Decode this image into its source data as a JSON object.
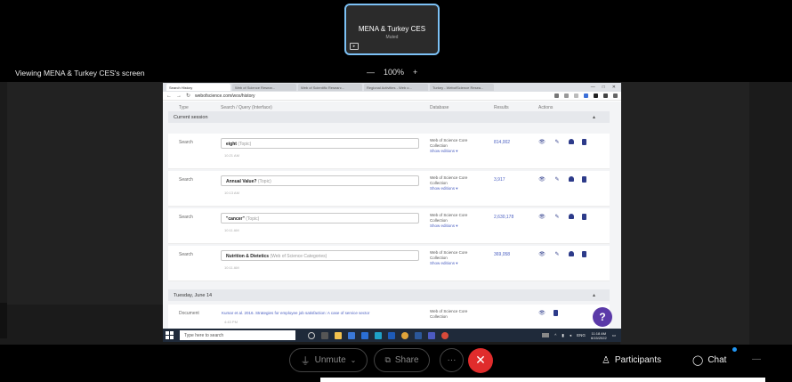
{
  "presenter_tile": {
    "name": "MENA & Turkey CES",
    "subtitle": "Muted"
  },
  "viewing_label": "Viewing MENA & Turkey CES's screen",
  "zoom_control": {
    "minus": "—",
    "level": "100%",
    "plus": "+"
  },
  "browser": {
    "tabs": [
      "Search History",
      "Web of Science Resear...",
      "Web of Scientific Researc...",
      "Regional Activities - Web o...",
      "Turkey - WebofScience Resea..."
    ],
    "window_controls": [
      "—",
      "□",
      "✕"
    ],
    "url": "webofscience.com/wos/history",
    "columns": {
      "type": "Type",
      "query": "Search / Query (Interface)",
      "database": "Database",
      "results": "Results",
      "actions": "Actions"
    },
    "sections": [
      {
        "label": "Current session",
        "caret": "▴"
      },
      {
        "label": "Tuesday, June 14",
        "caret": "▴"
      }
    ],
    "rows": [
      {
        "type": "Search",
        "query": "eight",
        "topic": "(Topic)",
        "time": "10:21 AM",
        "database": "Web of Science Core Collection",
        "more": "Show editions ▾",
        "results": "814,002"
      },
      {
        "type": "Search",
        "query": "Annual Value?",
        "topic": "(Topic)",
        "time": "10:13 AM",
        "database": "Web of Science Core Collection",
        "more": "Show editions ▾",
        "results": "3,917"
      },
      {
        "type": "Search",
        "query": "\"cancer\"",
        "topic": "(Topic)",
        "time": "10:11 AM",
        "database": "Web of Science Core Collection",
        "more": "Show editions ▾",
        "results": "2,630,178"
      },
      {
        "type": "Search",
        "query": "Nutrition & Dietetics",
        "topic": "(Web of Science Categories)",
        "time": "10:11 AM",
        "database": "Web of Science Core Collection",
        "more": "Show editions ▾",
        "results": "369,058"
      },
      {
        "type": "Document",
        "query": "Kumar et al. 2016. Strategies for employee job satisfaction: A case of service sector",
        "topic": "",
        "time": "4:43 PM",
        "database": "Web of Science Core Collection",
        "more": "",
        "results": ""
      }
    ],
    "help_label": "?"
  },
  "taskbar": {
    "search_placeholder": "Type here to search",
    "tray_text": "ENG",
    "time": "11:18 AM",
    "date": "6/15/2022"
  },
  "toolbar": {
    "unmute_label": "Unmute",
    "share_label": "Share",
    "more_label": "···",
    "end_label": "✕",
    "participants_label": "Participants",
    "chat_label": "Chat",
    "overflow_label": "—"
  },
  "colors": {
    "accent_blue": "#7cc1f5",
    "end_red": "#e02c2c",
    "wos_navy": "#2d3b8a",
    "help_purple": "#5b3aa8"
  }
}
